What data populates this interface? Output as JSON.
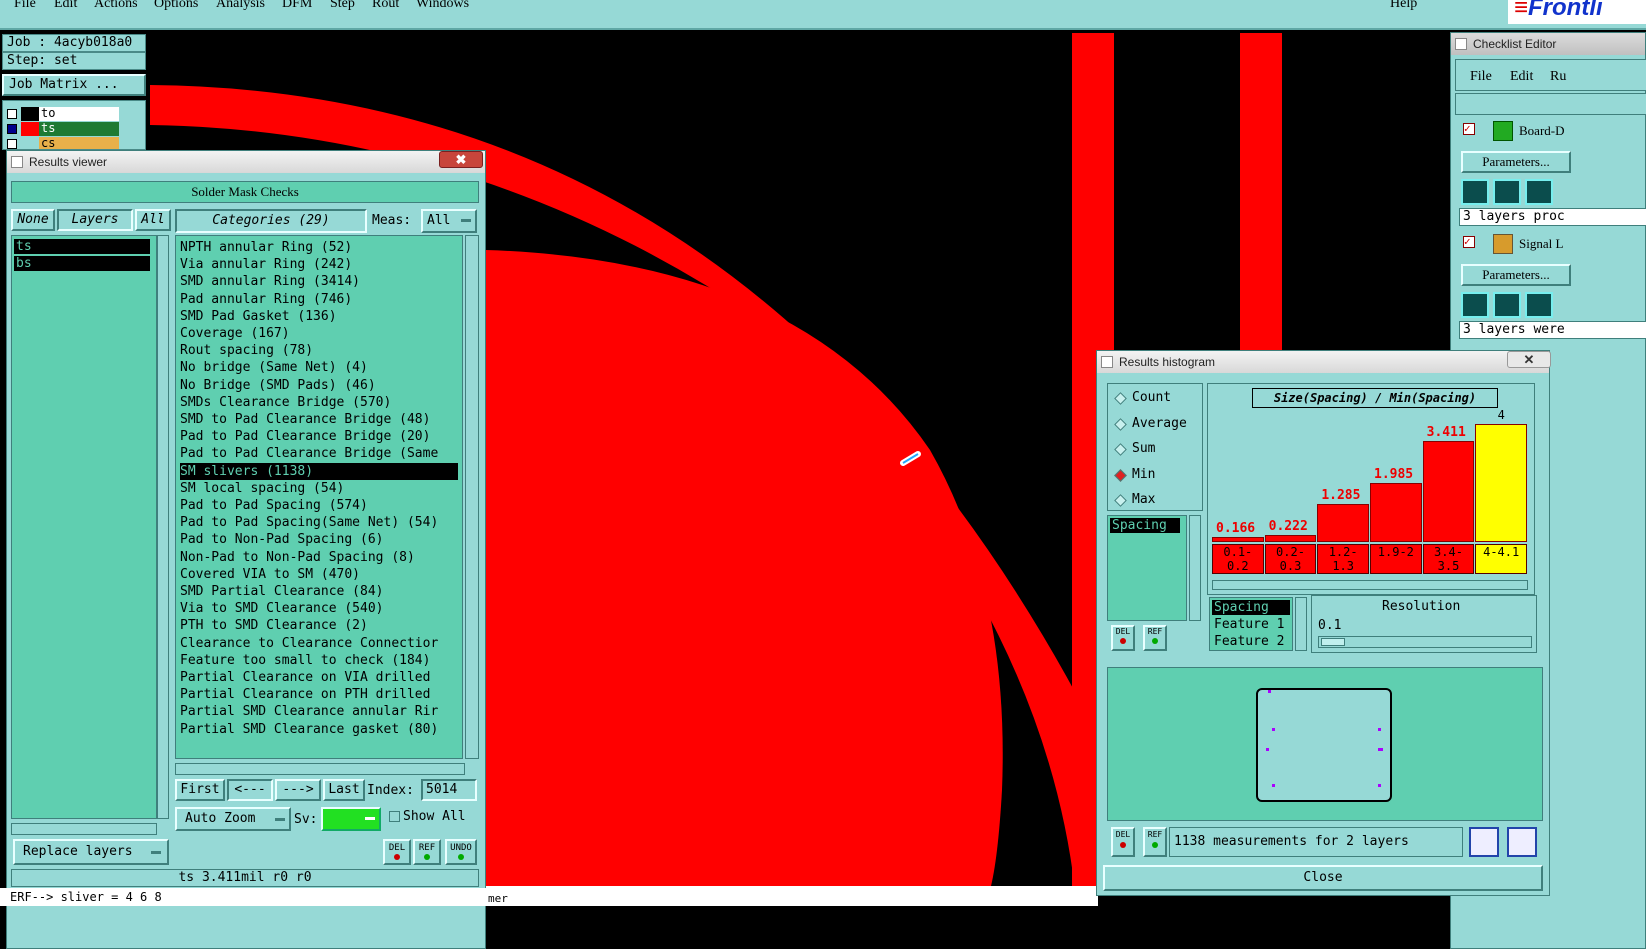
{
  "menubar": {
    "items": [
      "File",
      "Edit",
      "Actions",
      "Options",
      "Analysis",
      "DFM",
      "Step",
      "Rout",
      "Windows"
    ],
    "help": "Help",
    "logo": "Frontli"
  },
  "left": {
    "job": "Job : 4acyb018a0",
    "step": "Step: set",
    "job_matrix": "Job Matrix ...",
    "layers": [
      {
        "name": "to",
        "color": "#ffffff"
      },
      {
        "name": "ts",
        "color": "#1e7a33"
      },
      {
        "name": "cs",
        "color": "#e8b04a"
      }
    ]
  },
  "results_viewer": {
    "title": "Results viewer",
    "close": "✖",
    "header": "Solder Mask Checks",
    "none": "None",
    "layers": "Layers",
    "all": "All",
    "categories_btn": "Categories (29)",
    "meas_label": "Meas:",
    "meas_value": "All",
    "layer_items": [
      "ts",
      "bs"
    ],
    "categories": [
      "NPTH annular Ring (52)",
      "Via annular Ring (242)",
      "SMD annular Ring (3414)",
      "Pad annular Ring (746)",
      "SMD Pad Gasket (136)",
      "Coverage (167)",
      "Rout spacing (78)",
      "No bridge (Same Net) (4)",
      "No Bridge (SMD Pads) (46)",
      "SMDs Clearance Bridge (570)",
      "SMD to Pad Clearance Bridge (48)",
      "Pad to Pad Clearance Bridge (20)",
      "Pad to Pad Clearance Bridge (Same",
      "SM slivers (1138)",
      "SM local spacing (54)",
      "Pad to Pad Spacing (574)",
      "Pad to Pad Spacing(Same Net) (54)",
      "Pad to Non-Pad Spacing (6)",
      "Non-Pad to Non-Pad Spacing (8)",
      "Covered VIA to SM (470)",
      "SMD Partial Clearance (84)",
      "Via to SMD Clearance (540)",
      "PTH to SMD Clearance (2)",
      "Clearance to Clearance Connectior",
      "Feature too small to check (184)",
      "Partial Clearance on VIA drilled",
      "Partial Clearance on PTH drilled",
      "Partial SMD Clearance annular Rir",
      "Partial SMD Clearance gasket (80)"
    ],
    "selected_index": 13,
    "first": "First",
    "prev": "<---",
    "next": "--->",
    "last": "Last",
    "index_label": "Index:",
    "index_value": "5014",
    "auto_zoom": "Auto Zoom",
    "sv_label": "Sv:",
    "show_all": "Show All",
    "replace_layers": "Replace layers",
    "del": "DEL",
    "ref": "REF",
    "undo": "UNDO",
    "status": "ts 3.411mil  r0  r0",
    "erf": "ERF--> sliver = 4 6 8"
  },
  "checklist_editor": {
    "title": "Checklist Editor",
    "menu": [
      "File",
      "Edit",
      "Ru"
    ],
    "item1": "Board-D",
    "params": "Parameters...",
    "status1": "3 layers proc",
    "item2": "Signal L",
    "status2": "3 layers were"
  },
  "histogram": {
    "title": "Results histogram",
    "modes": [
      "Count",
      "Average",
      "Sum",
      "Min",
      "Max"
    ],
    "selected_mode": "Min",
    "list_item": "Spacing",
    "chart_title": "Size(Spacing) / Min(Spacing)",
    "top_label": "4",
    "sel_items": [
      "Spacing",
      "Feature 1",
      "Feature 2"
    ],
    "resolution_label": "Resolution",
    "resolution_value": "0.1",
    "measurements": "1138 measurements for 2 layers",
    "close": "Close",
    "del": "DEL",
    "ref": "REF"
  },
  "chart_data": {
    "type": "bar",
    "title": "Size(Spacing) / Min(Spacing)",
    "categories": [
      "0.1-0.2",
      "0.2-0.3",
      "1.2-1.3",
      "1.9-2",
      "3.4-3.5",
      "4-4.1"
    ],
    "values": [
      0.166,
      0.222,
      1.285,
      1.985,
      3.411,
      4
    ],
    "value_labels": [
      "0.166",
      "0.222",
      "1.285",
      "1.985",
      "3.411",
      ""
    ],
    "colors": [
      "#ff0000",
      "#ff0000",
      "#ff0000",
      "#ff0000",
      "#ff0000",
      "#ffff00"
    ],
    "ylim": [
      0,
      4
    ]
  },
  "bottom_text": "mer"
}
